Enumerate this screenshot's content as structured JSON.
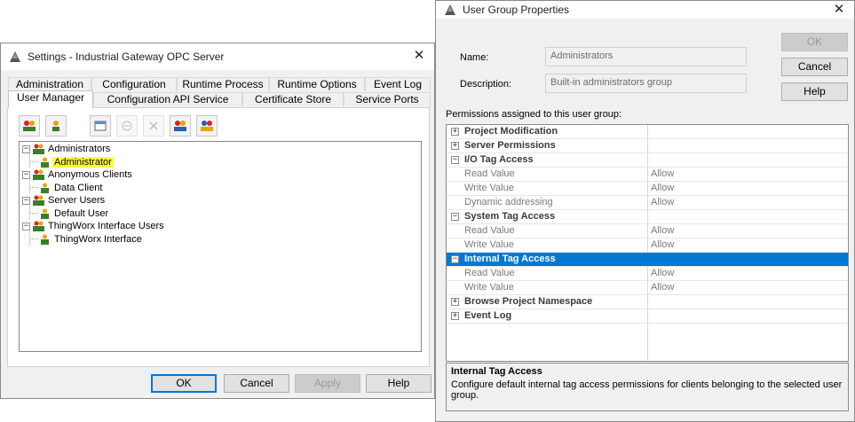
{
  "settings": {
    "title": "Settings - Industrial Gateway OPC Server",
    "tabs_row1": [
      "Administration",
      "Configuration",
      "Runtime Process",
      "Runtime Options",
      "Event Log"
    ],
    "tabs_row2": [
      "User Manager",
      "Configuration API Service",
      "Certificate Store",
      "Service Ports"
    ],
    "active_tab": "User Manager",
    "tree": [
      {
        "label": "Administrators",
        "level": 0
      },
      {
        "label": "Administrator",
        "level": 1,
        "selected": true
      },
      {
        "label": "Anonymous Clients",
        "level": 0
      },
      {
        "label": "Data Client",
        "level": 1
      },
      {
        "label": "Server Users",
        "level": 0
      },
      {
        "label": "Default User",
        "level": 1
      },
      {
        "label": "ThingWorx Interface Users",
        "level": 0
      },
      {
        "label": "ThingWorx Interface",
        "level": 1
      }
    ],
    "buttons": {
      "ok": "OK",
      "cancel": "Cancel",
      "apply": "Apply",
      "help": "Help"
    }
  },
  "props": {
    "title": "User Group Properties",
    "name_label": "Name:",
    "name_value": "Administrators",
    "description_label": "Description:",
    "description_value": "Built-in administrators group",
    "buttons": {
      "ok": "OK",
      "cancel": "Cancel",
      "help": "Help"
    },
    "permissions_heading": "Permissions assigned to this user group:",
    "rows": [
      {
        "type": "cat",
        "expander": "+",
        "name": "Project Modification"
      },
      {
        "type": "cat",
        "expander": "+",
        "name": "Server Permissions"
      },
      {
        "type": "cat",
        "expander": "−",
        "name": "I/O Tag Access"
      },
      {
        "type": "prop",
        "name": "Read Value",
        "value": "Allow"
      },
      {
        "type": "prop",
        "name": "Write Value",
        "value": "Allow"
      },
      {
        "type": "prop",
        "name": "Dynamic addressing",
        "value": "Allow"
      },
      {
        "type": "cat",
        "expander": "−",
        "name": "System Tag Access"
      },
      {
        "type": "prop",
        "name": "Read Value",
        "value": "Allow"
      },
      {
        "type": "prop",
        "name": "Write Value",
        "value": "Allow"
      },
      {
        "type": "cat",
        "expander": "−",
        "name": "Internal Tag Access",
        "selected": true
      },
      {
        "type": "prop",
        "name": "Read Value",
        "value": "Allow"
      },
      {
        "type": "prop",
        "name": "Write Value",
        "value": "Allow"
      },
      {
        "type": "cat",
        "expander": "+",
        "name": "Browse Project Namespace"
      },
      {
        "type": "cat",
        "expander": "+",
        "name": "Event Log"
      }
    ],
    "description_box": {
      "title": "Internal Tag Access",
      "text": "Configure default internal tag access permissions for clients belonging to the selected user group."
    }
  }
}
